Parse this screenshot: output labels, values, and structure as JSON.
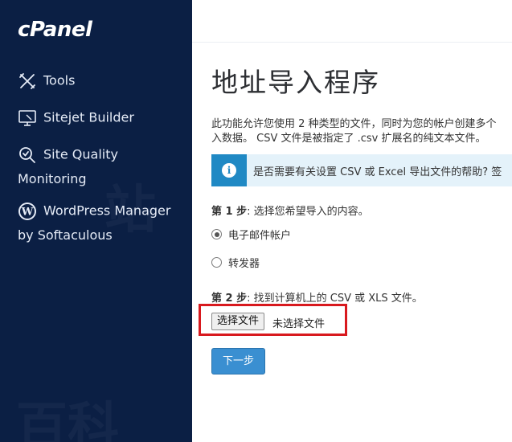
{
  "sidebar": {
    "logo": "cPanel",
    "items": [
      {
        "label": "Tools",
        "icon": "tools-icon"
      },
      {
        "label": "Sitejet Builder",
        "icon": "monitor-icon"
      },
      {
        "label_line1": "Site Quality",
        "label_line2": "Monitoring",
        "icon": "magnifier-check-icon"
      },
      {
        "label_line1": "WordPress Manager",
        "label_line2": "by Softaculous",
        "icon": "wordpress-icon"
      }
    ],
    "colors": {
      "background": "#0b1f44",
      "text": "#e6ecf7"
    }
  },
  "main": {
    "title": "地址导入程序",
    "description_line1": "此功能允许您使用 2 种类型的文件，同时为您的帐户创建多个",
    "description_line2": "入数据。 CSV 文件是被指定了 .csv 扩展名的纯文本文件。",
    "info": {
      "icon": "info-icon",
      "text": "是否需要有关设置 CSV 或 Excel 导出文件的帮助? 签"
    },
    "step1": {
      "prefix": "第 1 步",
      "text": ": 选择您希望导入的内容。",
      "options": [
        {
          "label": "电子邮件帐户",
          "checked": true
        },
        {
          "label": "转发器",
          "checked": false
        }
      ]
    },
    "step2": {
      "prefix": "第 2 步",
      "text": ": 找到计算机上的 CSV 或 XLS 文件。",
      "choose_file_label": "选择文件",
      "file_status": "未选择文件"
    },
    "next_button": "下一步",
    "colors": {
      "accent": "#3a8fd1",
      "info_bg": "#e4f2fa",
      "highlight": "#d8191e"
    }
  }
}
